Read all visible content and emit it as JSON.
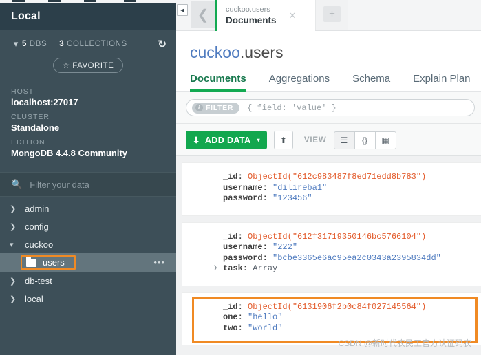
{
  "sidebar": {
    "connection_title": "Local",
    "stats": {
      "db_count": "5",
      "db_label": "DBS",
      "collection_count": "3",
      "collection_label": "COLLECTIONS",
      "refresh_icon": "refresh-icon",
      "caret_icon": "chevron-down-icon"
    },
    "favorite_button": "☆ FAVORITE",
    "info": [
      {
        "label": "HOST",
        "value": "localhost:27017"
      },
      {
        "label": "CLUSTER",
        "value": "Standalone"
      },
      {
        "label": "EDITION",
        "value": "MongoDB 4.4.8 Community"
      }
    ],
    "search": {
      "icon": "search-icon",
      "placeholder": "Filter your data"
    },
    "tree": [
      {
        "name": "admin",
        "expanded": false
      },
      {
        "name": "config",
        "expanded": false
      },
      {
        "name": "cuckoo",
        "expanded": true
      },
      {
        "name": "db-test",
        "expanded": false
      },
      {
        "name": "local",
        "expanded": false
      }
    ],
    "selected_collection": {
      "name": "users",
      "menu_icon": "ellipsis-icon",
      "folder_icon": "folder-icon",
      "highlight_color": "#f08a24"
    }
  },
  "tabbar": {
    "collapse_icon": "collapse-sidebar-icon",
    "back_icon": "chevron-left-icon",
    "tab": {
      "namespace": "cuckoo.users",
      "name": "Documents",
      "close_icon": "close-icon",
      "accent": "#13aa52"
    },
    "new_tab_label": "+"
  },
  "collection": {
    "db_name": "cuckoo",
    "separator": ".",
    "coll_name": "users",
    "tabs": [
      {
        "label": "Documents",
        "active": true
      },
      {
        "label": "Aggregations",
        "active": false
      },
      {
        "label": "Schema",
        "active": false
      },
      {
        "label": "Explain Plan",
        "active": false
      }
    ]
  },
  "filter": {
    "badge_label": "FILTER",
    "info_icon": "info-icon",
    "placeholder": "{ field: 'value' }"
  },
  "toolbar": {
    "add_data_label": "ADD DATA",
    "add_data_icon": "download-icon",
    "add_data_caret": "▾",
    "export_icon": "export-icon",
    "view_label": "VIEW",
    "views": [
      {
        "name": "list-view",
        "glyph": "☰",
        "active": true
      },
      {
        "name": "json-view",
        "glyph": "{}",
        "active": false
      },
      {
        "name": "table-view",
        "glyph": "▦",
        "active": false
      }
    ]
  },
  "documents": [
    {
      "highlighted": false,
      "fields": [
        {
          "key": "_id",
          "value": "ObjectId(\"612c983487f8ed71edd8b783\")",
          "type": "oid",
          "expandable": false
        },
        {
          "key": "username",
          "value": "\"dilireba1\"",
          "type": "str",
          "expandable": false
        },
        {
          "key": "password",
          "value": "\"123456\"",
          "type": "str",
          "expandable": false
        }
      ]
    },
    {
      "highlighted": false,
      "fields": [
        {
          "key": "_id",
          "value": "ObjectId(\"612f31719350146bc5766104\")",
          "type": "oid",
          "expandable": false
        },
        {
          "key": "username",
          "value": "\"222\"",
          "type": "str",
          "expandable": false
        },
        {
          "key": "password",
          "value": "\"bcbe3365e6ac95ea2c0343a2395834dd\"",
          "type": "str",
          "expandable": false
        },
        {
          "key": "task",
          "value": "Array",
          "type": "type",
          "expandable": true
        }
      ]
    },
    {
      "highlighted": true,
      "fields": [
        {
          "key": "_id",
          "value": "ObjectId(\"6131906f2b0c84f027145564\")",
          "type": "oid",
          "expandable": false
        },
        {
          "key": "one",
          "value": "\"hello\"",
          "type": "str",
          "expandable": false
        },
        {
          "key": "two",
          "value": "\"world\"",
          "type": "str",
          "expandable": false
        }
      ]
    }
  ],
  "watermark": "CSDN @新时代农民工官方认证码农"
}
